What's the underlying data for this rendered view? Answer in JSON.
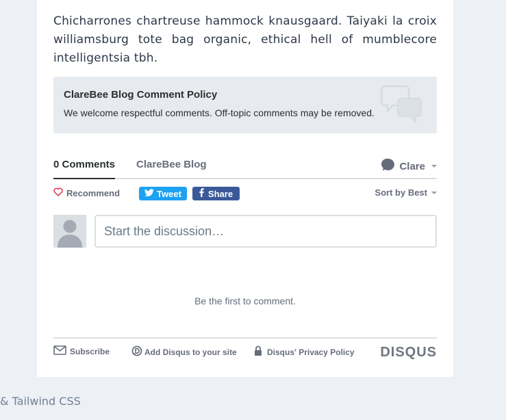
{
  "intro_text": "Chicharrones chartreuse hammock knausgaard. Taiyaki la croix williamsburg tote bag organic, ethical hell of mumblecore intelligentsia tbh.",
  "policy": {
    "title": "ClareBee Blog Comment Policy",
    "text": "We welcome respectful comments. Off-topic comments may be removed."
  },
  "tabs": {
    "comments": "0 Comments",
    "forum": "ClareBee Blog"
  },
  "user": {
    "name": "Clare"
  },
  "actions": {
    "recommend": "Recommend",
    "tweet": "Tweet",
    "share": "Share",
    "sort": "Sort by Best"
  },
  "composer": {
    "placeholder": "Start the discussion…"
  },
  "empty_state": "Be the first to comment.",
  "footer": {
    "subscribe": "Subscribe",
    "add_disqus": "Add Disqus to your site",
    "privacy": "Disqus' Privacy Policy",
    "brand": "DISQUS"
  },
  "page_footer": "& Tailwind CSS",
  "colors": {
    "tweet": "#1da1f2",
    "share": "#3b5998",
    "recommend_heart": "#e0344b",
    "background": "#edf0f5"
  }
}
